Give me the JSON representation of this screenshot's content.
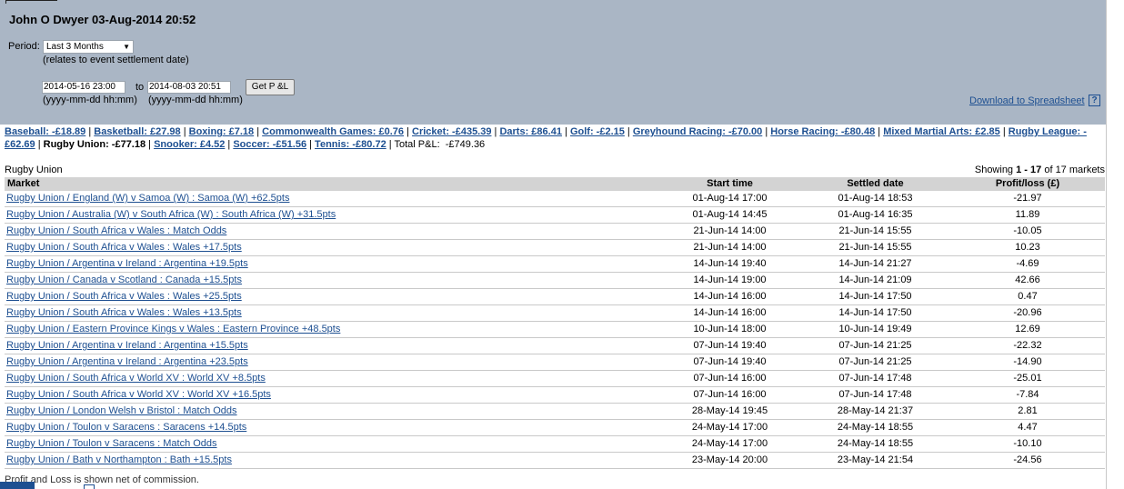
{
  "header": {
    "title": "John O Dwyer 03-Aug-2014 20:52",
    "period_label": "Period:",
    "period_value": "Last 3 Months",
    "period_note": "(relates to event settlement date)",
    "from_value": "2014-05-16 23:00",
    "to_label": "to",
    "to_value": "2014-08-03 20:51",
    "date_hint": "(yyyy-mm-dd hh:mm)",
    "get_button": "Get P &L",
    "download_link": "Download to Spreadsheet",
    "help_icon": "?"
  },
  "sports": [
    {
      "label": "Baseball: -£18.89",
      "link": true
    },
    {
      "label": "Basketball: £27.98",
      "link": true
    },
    {
      "label": "Boxing: £7.18",
      "link": true
    },
    {
      "label": "Commonwealth Games: £0.76",
      "link": true
    },
    {
      "label": "Cricket: -£435.39",
      "link": true
    },
    {
      "label": "Darts: £86.41",
      "link": true
    },
    {
      "label": "Golf: -£2.15",
      "link": true
    },
    {
      "label": "Greyhound Racing: -£70.00",
      "link": true
    },
    {
      "label": "Horse Racing: -£80.48",
      "link": true
    },
    {
      "label": "Mixed Martial Arts: £2.85",
      "link": true
    },
    {
      "label": "Rugby League: -£62.69",
      "link": true
    },
    {
      "label": "Rugby Union: -£77.18",
      "link": false
    },
    {
      "label": "Snooker: £4.52",
      "link": true
    },
    {
      "label": "Soccer: -£51.56",
      "link": true
    },
    {
      "label": "Tennis: -£80.72",
      "link": true
    }
  ],
  "total_pl": "Total P&L:  -£749.36",
  "section_title": "Rugby Union",
  "showing": {
    "prefix": "Showing ",
    "range": "1 - 17",
    "mid": " of ",
    "total": "17",
    "suffix": " markets"
  },
  "table": {
    "headers": [
      "Market",
      "Start time",
      "Settled date",
      "Profit/loss (£)"
    ],
    "rows": [
      [
        "Rugby Union / England (W) v Samoa (W) : Samoa (W) +62.5pts",
        "01-Aug-14 17:00",
        "01-Aug-14 18:53",
        "-21.97"
      ],
      [
        "Rugby Union / Australia (W) v South Africa (W) : South Africa (W) +31.5pts",
        "01-Aug-14 14:45",
        "01-Aug-14 16:35",
        "11.89"
      ],
      [
        "Rugby Union / South Africa v Wales : Match Odds",
        "21-Jun-14 14:00",
        "21-Jun-14 15:55",
        "-10.05"
      ],
      [
        "Rugby Union / South Africa v Wales : Wales +17.5pts",
        "21-Jun-14 14:00",
        "21-Jun-14 15:55",
        "10.23"
      ],
      [
        "Rugby Union / Argentina v Ireland : Argentina +19.5pts",
        "14-Jun-14 19:40",
        "14-Jun-14 21:27",
        "-4.69"
      ],
      [
        "Rugby Union / Canada v Scotland : Canada +15.5pts",
        "14-Jun-14 19:00",
        "14-Jun-14 21:09",
        "42.66"
      ],
      [
        "Rugby Union / South Africa v Wales : Wales +25.5pts",
        "14-Jun-14 16:00",
        "14-Jun-14 17:50",
        "0.47"
      ],
      [
        "Rugby Union / South Africa v Wales : Wales +13.5pts",
        "14-Jun-14 16:00",
        "14-Jun-14 17:50",
        "-20.96"
      ],
      [
        "Rugby Union / Eastern Province Kings v Wales : Eastern Province +48.5pts",
        "10-Jun-14 18:00",
        "10-Jun-14 19:49",
        "12.69"
      ],
      [
        "Rugby Union / Argentina v Ireland : Argentina +15.5pts",
        "07-Jun-14 19:40",
        "07-Jun-14 21:25",
        "-22.32"
      ],
      [
        "Rugby Union / Argentina v Ireland : Argentina +23.5pts",
        "07-Jun-14 19:40",
        "07-Jun-14 21:25",
        "-14.90"
      ],
      [
        "Rugby Union / South Africa v World XV : World XV +8.5pts",
        "07-Jun-14 16:00",
        "07-Jun-14 17:48",
        "-25.01"
      ],
      [
        "Rugby Union / South Africa v World XV : World XV +16.5pts",
        "07-Jun-14 16:00",
        "07-Jun-14 17:48",
        "-7.84"
      ],
      [
        "Rugby Union / London Welsh v Bristol : Match Odds",
        "28-May-14 19:45",
        "28-May-14 21:37",
        "2.81"
      ],
      [
        "Rugby Union / Toulon v Saracens : Saracens +14.5pts",
        "24-May-14 17:00",
        "24-May-14 18:55",
        "4.47"
      ],
      [
        "Rugby Union / Toulon v Saracens : Match Odds",
        "24-May-14 17:00",
        "24-May-14 18:55",
        "-10.10"
      ],
      [
        "Rugby Union / Bath v Northampton : Bath +15.5pts",
        "23-May-14 20:00",
        "23-May-14 21:54",
        "-24.56"
      ]
    ]
  },
  "footer_note": "Profit and Loss is shown net of commission.",
  "colors": {
    "header_bg": "#aab6c5",
    "link": "#1d4f91",
    "table_header_bg": "#d3d3d3"
  }
}
